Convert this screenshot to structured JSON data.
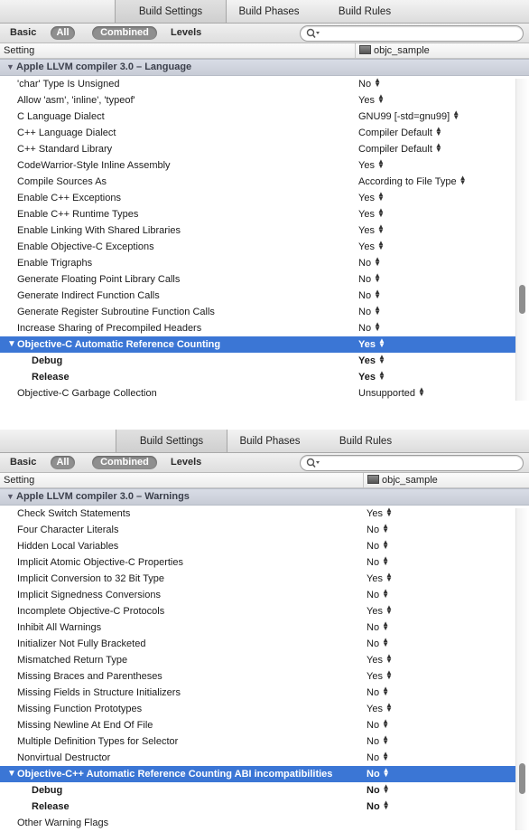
{
  "tabs": [
    "Build Settings",
    "Build Phases",
    "Build Rules"
  ],
  "filters": {
    "basic": "Basic",
    "all": "All",
    "combined": "Combined",
    "levels": "Levels"
  },
  "search": {
    "placeholder": ""
  },
  "columns": {
    "setting": "Setting",
    "target": "objc_sample"
  },
  "panel1": {
    "group": "Apple LLVM compiler 3.0 – Language",
    "rows": [
      {
        "name": "'char' Type Is Unsigned",
        "value": "No"
      },
      {
        "name": "Allow 'asm', 'inline', 'typeof'",
        "value": "Yes"
      },
      {
        "name": "C Language Dialect",
        "value": "GNU99 [-std=gnu99]"
      },
      {
        "name": "C++ Language Dialect",
        "value": "Compiler Default"
      },
      {
        "name": "C++ Standard Library",
        "value": "Compiler Default"
      },
      {
        "name": "CodeWarrior-Style Inline Assembly",
        "value": "Yes"
      },
      {
        "name": "Compile Sources As",
        "value": "According to File Type"
      },
      {
        "name": "Enable C++ Exceptions",
        "value": "Yes"
      },
      {
        "name": "Enable C++ Runtime Types",
        "value": "Yes"
      },
      {
        "name": "Enable Linking With Shared Libraries",
        "value": "Yes"
      },
      {
        "name": "Enable Objective-C Exceptions",
        "value": "Yes"
      },
      {
        "name": "Enable Trigraphs",
        "value": "No"
      },
      {
        "name": "Generate Floating Point Library Calls",
        "value": "No"
      },
      {
        "name": "Generate Indirect Function Calls",
        "value": "No"
      },
      {
        "name": "Generate Register Subroutine Function Calls",
        "value": "No"
      },
      {
        "name": "Increase Sharing of Precompiled Headers",
        "value": "No"
      },
      {
        "name": "Objective-C Automatic Reference Counting",
        "value": "Yes",
        "selected": true,
        "expanded": true
      },
      {
        "name": "Debug",
        "value": "Yes",
        "sub": true
      },
      {
        "name": "Release",
        "value": "Yes",
        "sub": true
      },
      {
        "name": "Objective-C Garbage Collection",
        "value": "Unsupported"
      }
    ]
  },
  "panel2": {
    "group": "Apple LLVM compiler 3.0 – Warnings",
    "rows": [
      {
        "name": "Check Switch Statements",
        "value": "Yes"
      },
      {
        "name": "Four Character Literals",
        "value": "No"
      },
      {
        "name": "Hidden Local Variables",
        "value": "No"
      },
      {
        "name": "Implicit Atomic Objective-C Properties",
        "value": "No"
      },
      {
        "name": "Implicit Conversion to 32 Bit Type",
        "value": "Yes"
      },
      {
        "name": "Implicit Signedness Conversions",
        "value": "No"
      },
      {
        "name": "Incomplete Objective-C Protocols",
        "value": "Yes"
      },
      {
        "name": "Inhibit All Warnings",
        "value": "No"
      },
      {
        "name": "Initializer Not Fully Bracketed",
        "value": "No"
      },
      {
        "name": "Mismatched Return Type",
        "value": "Yes"
      },
      {
        "name": "Missing Braces and Parentheses",
        "value": "Yes"
      },
      {
        "name": "Missing Fields in Structure Initializers",
        "value": "No"
      },
      {
        "name": "Missing Function Prototypes",
        "value": "Yes"
      },
      {
        "name": "Missing Newline At End Of File",
        "value": "No"
      },
      {
        "name": "Multiple Definition Types for Selector",
        "value": "No"
      },
      {
        "name": "Nonvirtual Destructor",
        "value": "No"
      },
      {
        "name": "Objective-C++ Automatic Reference Counting ABI incompatibilities",
        "value": "No",
        "selected": true,
        "expanded": true
      },
      {
        "name": "Debug",
        "value": "No",
        "sub": true
      },
      {
        "name": "Release",
        "value": "No",
        "sub": true
      },
      {
        "name": "Other Warning Flags",
        "value": ""
      }
    ]
  },
  "icons": {
    "group_toggle": "disclosure-triangle-icon",
    "stepper": "stepper-arrows-icon",
    "search": "search-icon",
    "target": "target-icon"
  },
  "colors": {
    "selection": "#3b76d5",
    "group_header": "#cfd3dc",
    "pill": "#8f8f8f"
  }
}
